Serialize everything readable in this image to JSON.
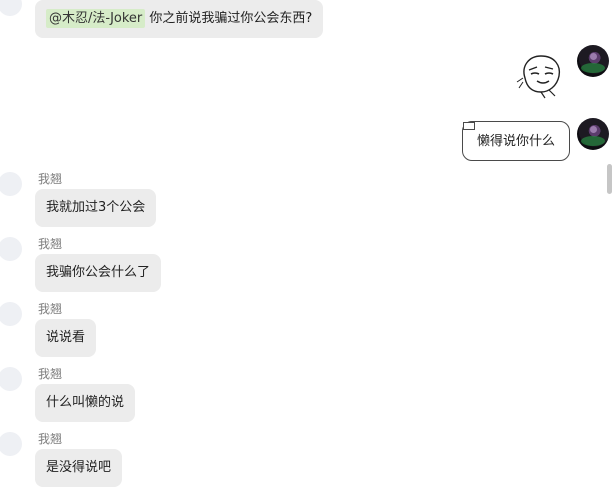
{
  "messages": {
    "first": {
      "mention": "@木忍/法-Joker",
      "text": " 你之前说我骗过你公会东西?"
    },
    "sticker": {
      "icon": "meme-face-sticker-icon"
    },
    "self_reply": {
      "text": "懒得说你什么"
    },
    "others": [
      {
        "sender": "我翘",
        "text": "我就加过3个公会"
      },
      {
        "sender": "我翘",
        "text": "我骗你公会什么了"
      },
      {
        "sender": "我翘",
        "text": "说说看"
      },
      {
        "sender": "我翘",
        "text": "什么叫懒的说"
      },
      {
        "sender": "我翘",
        "text": "是没得说吧"
      }
    ]
  },
  "colors": {
    "bubble_gray": "#ececec",
    "mention_highlight": "#d6ecc8",
    "sender_name": "#7d7d7d"
  }
}
